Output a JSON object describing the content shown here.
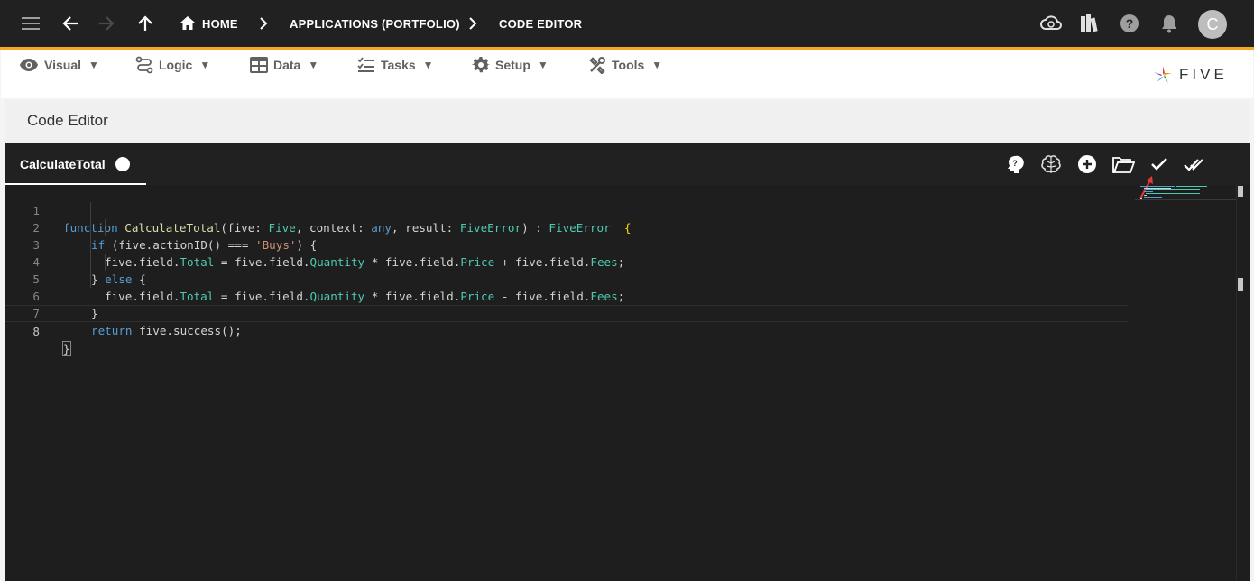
{
  "topbar": {
    "breadcrumbs": [
      "HOME",
      "APPLICATIONS (PORTFOLIO)",
      "CODE EDITOR"
    ],
    "avatar_initial": "C",
    "icons": [
      "menu-icon",
      "back-arrow-icon",
      "forward-arrow-icon",
      "up-arrow-icon",
      "home-icon",
      "cloud-sync-icon",
      "library-books-icon",
      "help-icon",
      "bell-icon"
    ]
  },
  "menu": {
    "items": [
      {
        "label": "Visual",
        "icon": "eye-icon"
      },
      {
        "label": "Logic",
        "icon": "flow-icon"
      },
      {
        "label": "Data",
        "icon": "table-icon"
      },
      {
        "label": "Tasks",
        "icon": "checklist-icon"
      },
      {
        "label": "Setup",
        "icon": "gear-icon"
      },
      {
        "label": "Tools",
        "icon": "tools-icon"
      }
    ],
    "caret": "▼",
    "logo_text": "FIVE"
  },
  "page": {
    "title": "Code Editor"
  },
  "editor": {
    "tab_label": "CalculateTotal",
    "toolbar": [
      "assistant-icon",
      "brain-icon",
      "add-circle-icon",
      "open-folder-icon",
      "check-icon",
      "double-check-icon"
    ],
    "line_numbers": [
      "1",
      "2",
      "3",
      "4",
      "5",
      "6",
      "7",
      "8"
    ],
    "active_line": "8",
    "colors": {
      "keyword": "#569cd6",
      "function": "#dcdcaa",
      "type": "#4ec9b0",
      "string": "#ce9178",
      "plain": "#d4d4d4"
    },
    "tokens": {
      "l1": [
        "function",
        "CalculateTotal",
        "(five: ",
        "Five",
        ", context: ",
        "any",
        ", result: ",
        "FiveError",
        ") : ",
        "FiveError",
        "  {"
      ],
      "l2": [
        "if",
        " (five.actionID() === ",
        "'Buys'",
        ") {"
      ],
      "l3": [
        "five.field.",
        "Total",
        " = five.field.",
        "Quantity",
        " * five.field.",
        "Price",
        " + five.field.",
        "Fees",
        ";"
      ],
      "l4": [
        "} ",
        "else",
        " {"
      ],
      "l5": [
        "five.field.",
        "Total",
        " = five.field.",
        "Quantity",
        " * five.field.",
        "Price",
        " - five.field.",
        "Fees",
        ";"
      ],
      "l6": [
        "}"
      ],
      "l7": [
        "return",
        " five.success();"
      ],
      "l8": [
        "}"
      ]
    }
  }
}
